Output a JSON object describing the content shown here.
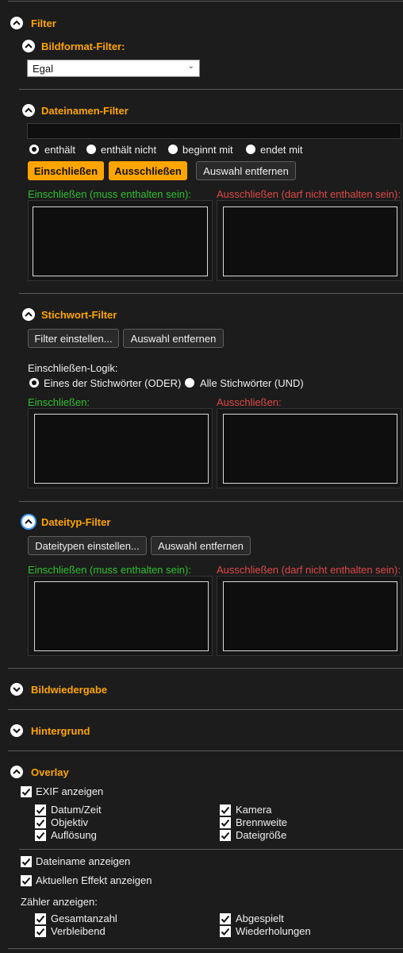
{
  "filter": {
    "title": "Filter",
    "bildformat": {
      "title": "Bildformat-Filter:",
      "select_value": "Egal"
    },
    "dateinamen": {
      "title": "Dateinamen-Filter",
      "input_value": "",
      "radio": [
        "enthält",
        "enthält nicht",
        "beginnt mit",
        "endet mit"
      ],
      "radio_selected": "enthält",
      "btn_include": "Einschließen",
      "btn_exclude": "Ausschließen",
      "btn_clear": "Auswahl entfernen",
      "include_label": "Einschließen (muss enthalten sein):",
      "exclude_label": "Ausschließen (darf nicht enthalten sein):"
    },
    "stichwort": {
      "title": "Stichwort-Filter",
      "btn_set": "Filter einstellen...",
      "btn_clear": "Auswahl entfernen",
      "logic_label": "Einschließen-Logik:",
      "radio": [
        "Eines der Stichwörter (ODER)",
        "Alle Stichwörter (UND)"
      ],
      "radio_selected": "Eines der Stichwörter (ODER)",
      "include_label": "Einschließen:",
      "exclude_label": "Ausschließen:"
    },
    "dateityp": {
      "title": "Dateityp-Filter",
      "btn_set": "Dateitypen einstellen...",
      "btn_clear": "Auswahl entfernen",
      "include_label": "Einschließen (muss enthalten sein):",
      "exclude_label": "Ausschließen (darf nicht enthalten sein):"
    }
  },
  "bildwiedergabe": {
    "title": "Bildwiedergabe"
  },
  "hintergrund": {
    "title": "Hintergrund"
  },
  "overlay": {
    "title": "Overlay",
    "exif_label": "EXIF anzeigen",
    "exif_items": [
      "Datum/Zeit",
      "Objektiv",
      "Auflösung",
      "Kamera",
      "Brennweite",
      "Dateigröße"
    ],
    "dateiname_label": "Dateiname anzeigen",
    "effekt_label": "Aktuellen Effekt anzeigen",
    "zaehler_label": "Zähler anzeigen:",
    "counter_items": [
      "Gesamtanzahl",
      "Verbleibend",
      "Abgespielt",
      "Wiederholungen"
    ]
  },
  "colors": {
    "accent": "#ffa500",
    "include_green": "#30c030",
    "exclude_red": "#e04848",
    "background": "#1c1c1c"
  },
  "icons": {
    "expanded": "chevron-up-icon",
    "collapsed": "chevron-down-icon",
    "checked": "checkmark-icon"
  }
}
